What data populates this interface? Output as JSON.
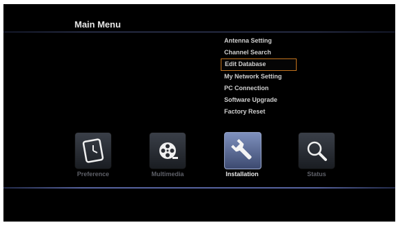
{
  "main_menu": {
    "title": "Main Menu"
  },
  "submenu": {
    "items": [
      {
        "label": "Antenna Setting"
      },
      {
        "label": "Channel Search"
      },
      {
        "label": "Edit Database"
      },
      {
        "label": "My Network Setting"
      },
      {
        "label": "PC Connection"
      },
      {
        "label": "Software Upgrade"
      },
      {
        "label": "Factory Reset"
      }
    ],
    "selected_label": "Edit Database"
  },
  "categories": [
    {
      "label": "Preference",
      "icon": "clock-icon"
    },
    {
      "label": "Multimedia",
      "icon": "film-reel-icon"
    },
    {
      "label": "Installation",
      "icon": "wrench-icon"
    },
    {
      "label": "Status",
      "icon": "magnifier-icon"
    }
  ],
  "active_category": "Installation",
  "colors": {
    "background": "#000000",
    "selection_border": "#c5741d",
    "divider": "#5864a0",
    "active_tile": "#7e90bd"
  }
}
